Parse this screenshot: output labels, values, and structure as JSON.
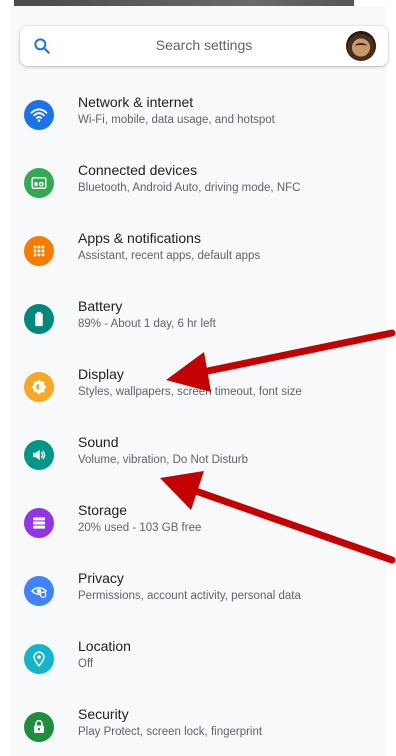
{
  "search": {
    "placeholder": "Search settings",
    "icon": "search-icon"
  },
  "colors": {
    "network": "#1a73e8",
    "connected": "#34a853",
    "apps": "#f57c00",
    "battery": "#00897b",
    "display": "#f9a825",
    "sound": "#009688",
    "storage": "#9334e6",
    "privacy": "#3f83f8",
    "location": "#12b5cb",
    "security": "#1e8e3e",
    "arrow": "#c40000"
  },
  "items": [
    {
      "title": "Network & internet",
      "subtitle": "Wi-Fi, mobile, data usage, and hotspot",
      "icon": "wifi-icon"
    },
    {
      "title": "Connected devices",
      "subtitle": "Bluetooth, Android Auto, driving mode, NFC",
      "icon": "connected-devices-icon"
    },
    {
      "title": "Apps & notifications",
      "subtitle": "Assistant, recent apps, default apps",
      "icon": "apps-grid-icon"
    },
    {
      "title": "Battery",
      "subtitle": "89% - About 1 day, 6 hr left",
      "icon": "battery-icon"
    },
    {
      "title": "Display",
      "subtitle": "Styles, wallpapers, screen timeout, font size",
      "icon": "brightness-icon"
    },
    {
      "title": "Sound",
      "subtitle": "Volume, vibration, Do Not Disturb",
      "icon": "speaker-icon"
    },
    {
      "title": "Storage",
      "subtitle": "20% used - 103 GB free",
      "icon": "storage-icon"
    },
    {
      "title": "Privacy",
      "subtitle": "Permissions, account activity, personal data",
      "icon": "privacy-eye-icon"
    },
    {
      "title": "Location",
      "subtitle": "Off",
      "icon": "location-pin-icon"
    },
    {
      "title": "Security",
      "subtitle": "Play Protect, screen lock, fingerprint",
      "icon": "lock-icon"
    }
  ]
}
